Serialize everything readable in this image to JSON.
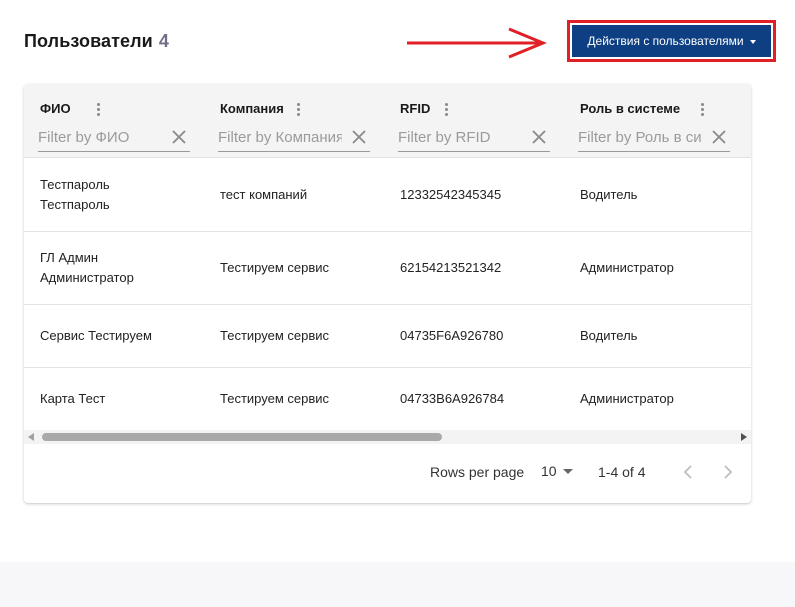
{
  "header": {
    "title": "Пользователи",
    "count": "4",
    "actions_label": "Действия с пользователями"
  },
  "table": {
    "columns": [
      {
        "label": "ФИО",
        "filter_placeholder": "Filter by ФИО"
      },
      {
        "label": "Компания",
        "filter_placeholder": "Filter by Компания"
      },
      {
        "label": "RFID",
        "filter_placeholder": "Filter by RFID"
      },
      {
        "label": "Роль в системе",
        "filter_placeholder": "Filter by Роль в системе"
      }
    ],
    "rows": [
      {
        "name": "Тестпароль Тестпароль",
        "company": "тест компаний",
        "rfid": "12332542345345",
        "role": "Водитель"
      },
      {
        "name": "ГЛ Админ Администратор",
        "company": "Тестируем сервис",
        "rfid": "62154213521342",
        "role": "Администратор"
      },
      {
        "name": "Сервис Тестируем",
        "company": "Тестируем сервис",
        "rfid": "04735F6A926780",
        "role": "Водитель"
      },
      {
        "name": "Карта Тест",
        "company": "Тестируем сервис",
        "rfid": "04733B6A926784",
        "role": "Администратор"
      }
    ]
  },
  "pagination": {
    "rows_per_page_label": "Rows per page",
    "rows_per_page_value": "10",
    "range_label": "1-4 of 4"
  },
  "icons": {
    "column_menu": "more-vert-icon",
    "filter_clear": "close-icon",
    "prev_page": "chevron-left-icon",
    "next_page": "chevron-right-icon",
    "dropdown": "caret-down-icon",
    "annotation_arrow": "arrow-right-icon"
  },
  "colors": {
    "primary_button": "#0d3f82",
    "highlight_border": "#e01f26",
    "annotation_arrow": "#e01f26",
    "count_text": "#6f6f86"
  }
}
